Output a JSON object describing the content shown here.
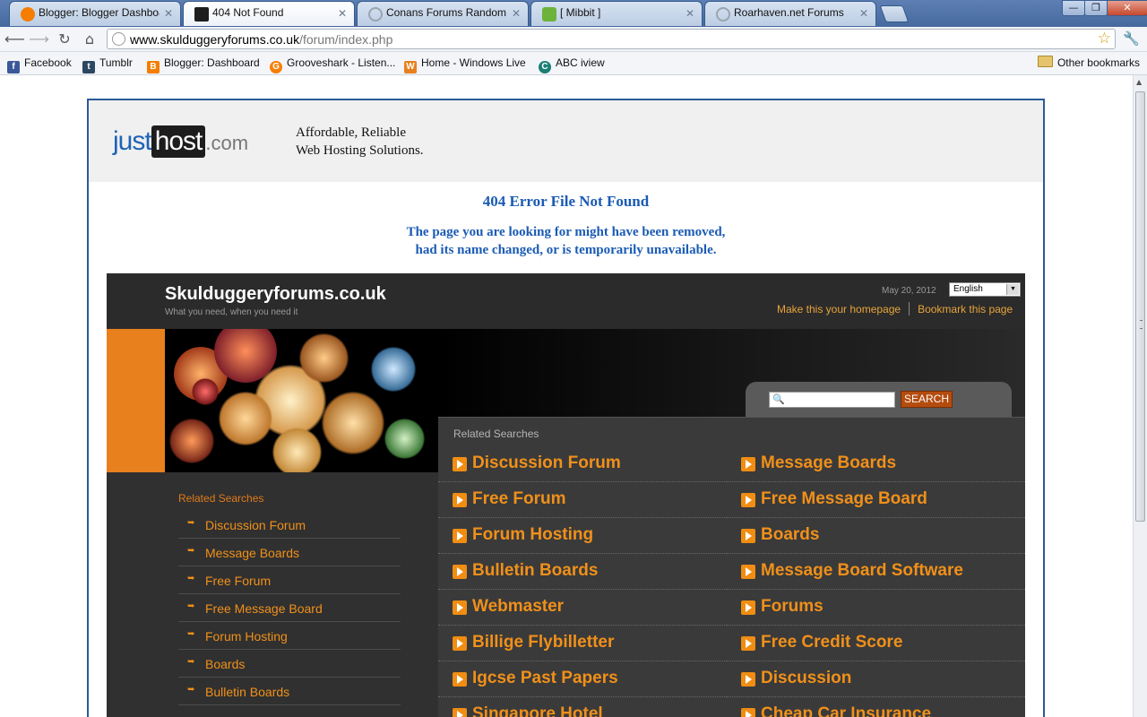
{
  "browser": {
    "tabs": [
      {
        "title": "Blogger: Blogger Dashboard",
        "icon": "blogger-icon",
        "color": "#f57d00",
        "active": false
      },
      {
        "title": "404 Not Found",
        "icon": "justhost-icon",
        "color": "#1d1d1d",
        "active": true
      },
      {
        "title": "Conans Forums Random M",
        "icon": "globe-icon",
        "color": "#9aa4b0",
        "active": false
      },
      {
        "title": "[ Mibbit ]",
        "icon": "mibbit-icon",
        "color": "#6bb33a",
        "active": false
      },
      {
        "title": "Roarhaven.net Forums",
        "icon": "globe-icon",
        "color": "#9aa4b0",
        "active": false
      }
    ],
    "url_host": "www.skulduggeryforums.co.uk",
    "url_path": "/forum/index.php",
    "bookmarks": [
      {
        "label": "Facebook",
        "glyph": "f",
        "color": "#3b5998"
      },
      {
        "label": "Tumblr",
        "glyph": "t",
        "color": "#2c4762"
      },
      {
        "label": "Blogger: Dashboard",
        "glyph": "B",
        "color": "#f57d00"
      },
      {
        "label": "Grooveshark - Listen...",
        "glyph": "G",
        "color": "#f77f00"
      },
      {
        "label": "Home - Windows Live",
        "glyph": "W",
        "color": "#e8801d"
      },
      {
        "label": "ABC iview",
        "glyph": "C",
        "color": "#1a7e74"
      }
    ],
    "other_bookmarks": "Other bookmarks"
  },
  "host": {
    "logo_just": "just",
    "logo_host": "host",
    "logo_com": ".com",
    "tagline_1": "Affordable, Reliable",
    "tagline_2": "Web Hosting Solutions."
  },
  "error": {
    "title": "404 Error File Not Found",
    "line1": "The page you are looking for might have been removed,",
    "line2": "had its name changed, or is temporarily unavailable."
  },
  "park": {
    "site_title": "Skulduggeryforums.co.uk",
    "site_sub": "What you need, when you need it",
    "date": "May 20, 2012",
    "language": "English",
    "link_homepage": "Make this your homepage",
    "link_bookmark": "Bookmark this page",
    "search_button": "SEARCH",
    "search_value": "",
    "related_title": "Related Searches",
    "related_left": [
      "Discussion Forum",
      "Free Forum",
      "Forum Hosting",
      "Bulletin Boards",
      "Webmaster",
      "Billige Flybilletter",
      "Igcse Past Papers",
      "Singapore Hotel"
    ],
    "related_right": [
      "Message Boards",
      "Free Message Board",
      "Boards",
      "Message Board Software",
      "Forums",
      "Free Credit Score",
      "Discussion",
      "Cheap Car Insurance"
    ],
    "sidebar_title": "Related Searches",
    "sidebar_items": [
      "Discussion Forum",
      "Message Boards",
      "Free Forum",
      "Free Message Board",
      "Forum Hosting",
      "Boards",
      "Bulletin Boards"
    ]
  },
  "colors": {
    "accent_orange": "#f0901a",
    "error_blue": "#1a5bb5",
    "frame_blue": "#2b5b99"
  }
}
